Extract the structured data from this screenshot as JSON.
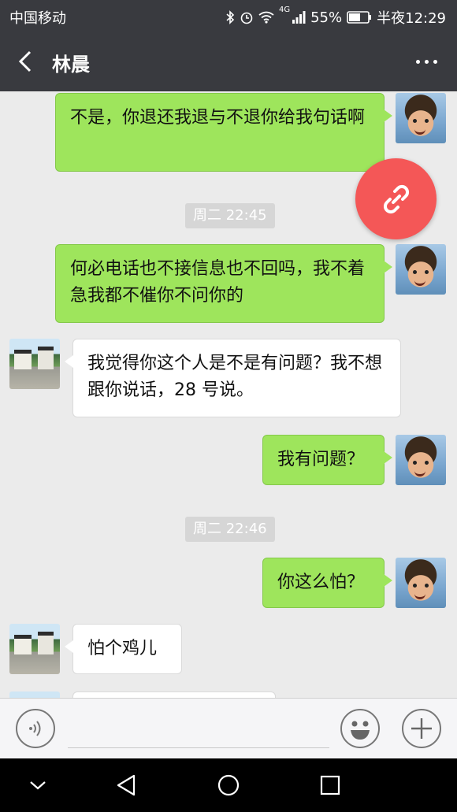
{
  "status_bar": {
    "carrier": "中国移动",
    "network": "4G",
    "battery": "55%",
    "time": "半夜12:29"
  },
  "header": {
    "title": "林晨"
  },
  "messages": [
    {
      "sender": "me",
      "text": "不是，你退还我退与不退你给我句话啊"
    },
    {
      "timestamp": "周二 22:45"
    },
    {
      "sender": "me",
      "text": "何必电话也不接信息也不回吗，我不着急我都不催你不问你的"
    },
    {
      "sender": "other",
      "text": "我觉得你这个人是不是有问题？我不想跟你说话，28 号说。"
    },
    {
      "sender": "me",
      "text": "我有问题？"
    },
    {
      "timestamp": "周二 22:46"
    },
    {
      "sender": "me",
      "text": "你这么怕？"
    },
    {
      "sender": "other",
      "text": "怕个鸡儿"
    }
  ],
  "floating_action": {
    "icon": "link-icon",
    "color": "#f45757"
  },
  "input_bar": {
    "left_icon": "voice-icon",
    "emoji_icon": "emoji-icon",
    "plus_icon": "plus-icon"
  },
  "colors": {
    "header": "#393a3f",
    "my_bubble": "#9ee55c",
    "chat_bg": "#ebebeb"
  }
}
